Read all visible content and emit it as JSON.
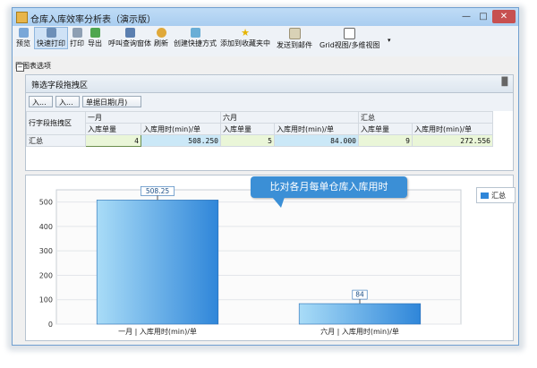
{
  "window": {
    "title": "仓库入库效率分析表（演示版）"
  },
  "toolbar": {
    "items": [
      {
        "label": "预览",
        "icon": "preview-icon"
      },
      {
        "label": "快速打印",
        "icon": "quick-print-icon"
      },
      {
        "label": "打印",
        "icon": "print-icon"
      },
      {
        "label": "导出",
        "icon": "export-icon"
      },
      {
        "label": "呼叫查询窗体",
        "icon": "query-window-icon"
      },
      {
        "label": "刷新",
        "icon": "refresh-icon"
      },
      {
        "label": "创建快捷方式",
        "icon": "shortcut-icon"
      },
      {
        "label": "添加到收藏夹中",
        "icon": "favorite-star-icon"
      },
      {
        "label": "发送到邮件",
        "icon": "mail-icon"
      },
      {
        "label": "Grid视图/多维视图",
        "icon": "grid-view-icon"
      }
    ],
    "chart_options": "田图表选项"
  },
  "grid": {
    "header": "筛选字段拖拽区",
    "filter_buttons": [
      "入...",
      "入...",
      "单据日期(月)"
    ],
    "row_field_label": "行字段拖拽区",
    "columns": {
      "group1": "一月",
      "group2": "六月",
      "group3": "汇总",
      "qty": "入库单量",
      "time": "入库用时(min)/单"
    },
    "row": {
      "label": "汇总",
      "jan_qty": "4",
      "jan_time": "508.250",
      "jun_qty": "5",
      "jun_time": "84.000",
      "total_qty": "9",
      "total_time": "272.556"
    }
  },
  "callout": "比对各月每单仓库入库用时",
  "colors": {
    "bar": "#2f86d9",
    "accent": "#3b8fd6"
  },
  "chart_data": {
    "type": "bar",
    "categories": [
      "一月 | 入库用时(min)/单",
      "六月 | 入库用时(min)/单"
    ],
    "series": [
      {
        "name": "汇总",
        "values": [
          508.25,
          84
        ]
      }
    ],
    "data_labels": [
      "508.25",
      "84"
    ],
    "ylim": [
      0,
      550
    ],
    "yticks": [
      "0",
      "100",
      "200",
      "300",
      "400",
      "500"
    ],
    "legend_position": "top-right",
    "grid": true
  }
}
